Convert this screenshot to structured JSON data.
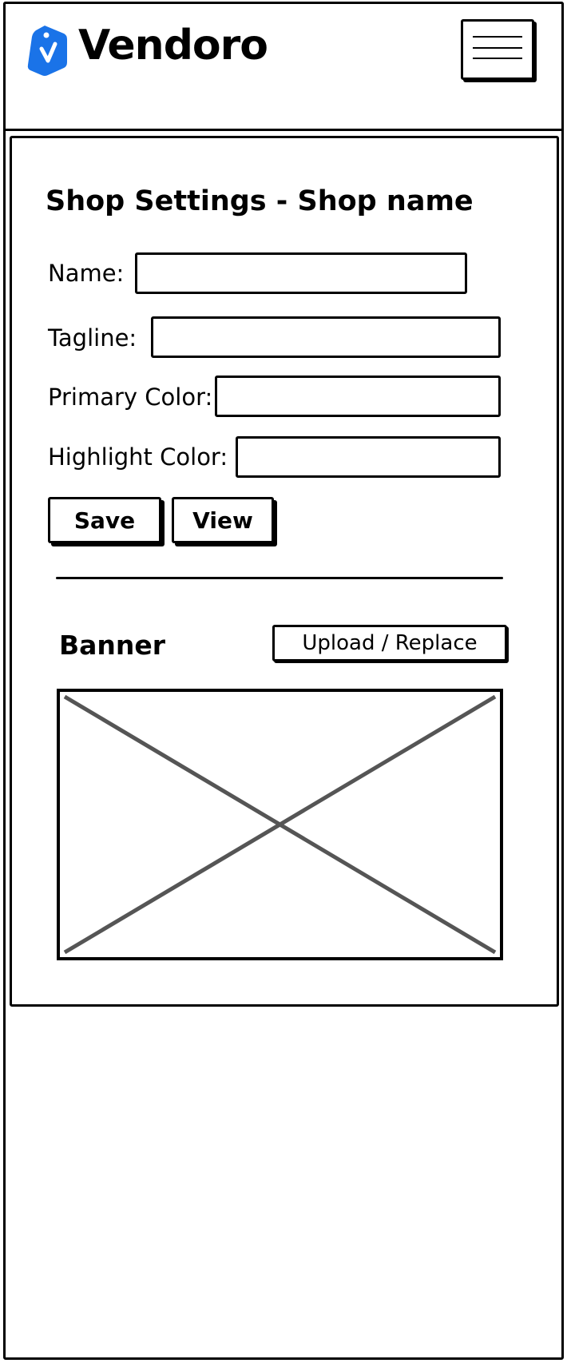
{
  "header": {
    "brand": "Vendoro",
    "logo_icon": "price-tag-icon",
    "menu_icon": "hamburger-menu-icon",
    "brand_color": "#1a73e8"
  },
  "page": {
    "title": "Shop Settings - Shop name"
  },
  "form": {
    "fields": [
      {
        "label": "Name:",
        "value": "",
        "placeholder": ""
      },
      {
        "label": "Tagline:",
        "value": "",
        "placeholder": ""
      },
      {
        "label": "Primary Color:",
        "value": "",
        "placeholder": ""
      },
      {
        "label": "Highlight Color:",
        "value": "",
        "placeholder": ""
      }
    ],
    "save_label": "Save",
    "view_label": "View"
  },
  "banner": {
    "label": "Banner",
    "upload_label": "Upload / Replace",
    "placeholder_icon": "image-placeholder-icon"
  }
}
